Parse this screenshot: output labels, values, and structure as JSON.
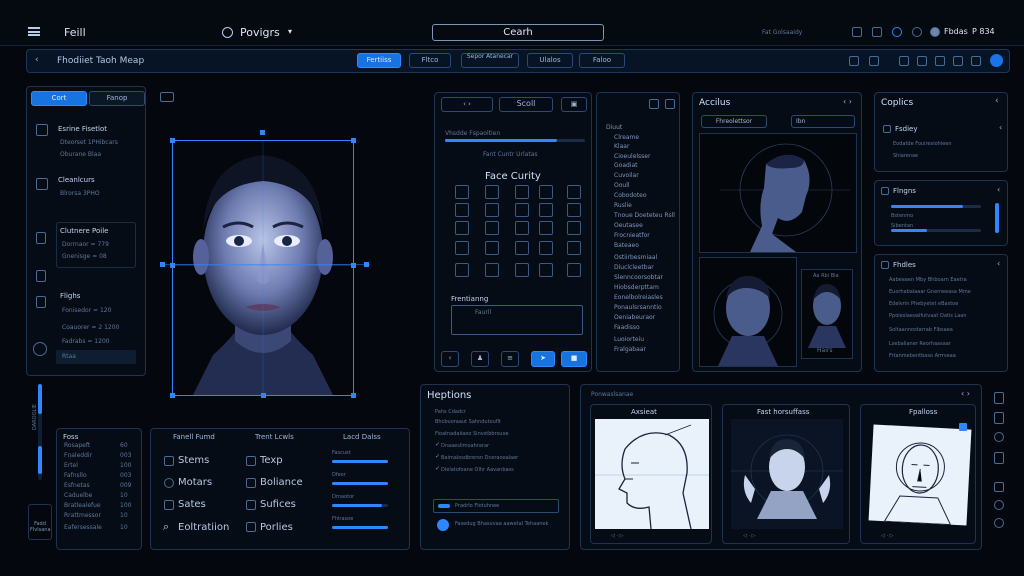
{
  "topbar": {
    "app_title": "Feill",
    "project_label": "Povigrs",
    "center_title": "Cearh",
    "right_label": "Fbdas",
    "right_value": "P 834",
    "sub_right": "Fat Golsaaidy"
  },
  "toolbar": {
    "path": "Fhodiiet Taoh Meap",
    "buttons": [
      "Fertiiss",
      "Fltco",
      "Sepor Atanecar",
      "Ulalos",
      "Faloo"
    ]
  },
  "left_tabs": [
    "Cort",
    "Fanop"
  ],
  "left_panel": {
    "sections": [
      {
        "title": "Esrine Fisetlot",
        "lines": [
          "Dteorset 1PHibcars",
          "Oburane Blaa"
        ]
      },
      {
        "title": "Cleanlcurs",
        "lines": [
          "Blrorsa 3PHO"
        ]
      },
      {
        "title": "Clutnere Poile",
        "lines": [
          "Dorrnaor = 779",
          "Gnenisge = 08"
        ]
      },
      {
        "title": "Flighs",
        "lines": [
          "Fonisedor = 120",
          "Coauorer = 2 1200",
          "Fadrabs = 1200"
        ]
      },
      {
        "title": "",
        "lines": [
          "Rtaa"
        ]
      }
    ],
    "vertical_label": "DAROOLIE",
    "bottom_btn": "Fadd Flvlsana"
  },
  "face_panel": {},
  "analysis_panel": {
    "tabs": [
      "Scoll"
    ],
    "subtitle": "Vhsdde Fspaoltien",
    "caption": "Fant Cuntr Urlatas",
    "title": "Face Curity",
    "grid_section": "Frentianng",
    "grid_label": "Faurll",
    "list": [
      "Diuut",
      "Clreame",
      "Klaar",
      "Cioeulelsser",
      "Goadiat",
      "Cuvoilar",
      "Ooull",
      "Cobodoteo",
      "Ruslie",
      "Tnoue Doeteteu Rsll",
      "Oeutasee",
      "Frocnieatfor",
      "Bateaeo",
      "Ostiirbesmiaal",
      "Diuclcleetbar",
      "Slenncoorsobtar",
      "Hiobsderpttam",
      "Eonelbolreiasles",
      "Ponaulsrsanntio",
      "Oeniabeuraor",
      "Faadisso",
      "Luoiorteiu",
      "Fralgabaar"
    ]
  },
  "accius_panel": {
    "title": "Accilus",
    "inputs": [
      "Fhreolettsor",
      "Ibn"
    ],
    "thumb_label": "Aa Rbi Bla",
    "thumb_caption": "Hairs"
  },
  "right_panels": {
    "top_title": "Coplics",
    "card1_title": "Fsdiey",
    "card1_lines": [
      "Eodatde Fouiresiohieen",
      "Shiarenae"
    ],
    "card2_title": "Flngns",
    "card2_lines": [
      "Bstenmo",
      "Sibentan"
    ],
    "card3_title": "Fhdles",
    "card3_lines": [
      "Aabeeaen Mby Bhboarn Eaetra",
      "Euorhabalaaar Gnemeeasa Mme",
      "Edelvrin Phebyetet eBastoe",
      "Ppoieslaeoalfutvaat Oatis Laan",
      "Soltaannostarrab Flbsaea",
      "Lsebalianer Reorhaasaar",
      "Frtanmebentbaso Arrrseaa"
    ]
  },
  "bottom_left": {
    "title": "Foss",
    "rows": [
      [
        "Rosapeft",
        "60"
      ],
      [
        "Fnaleddir",
        "003"
      ],
      [
        "Ertel",
        "100"
      ],
      [
        "Fafnsllo",
        "003"
      ],
      [
        "Esfnetas",
        "009"
      ],
      [
        "Caduelbe",
        "10"
      ],
      [
        "Bratlealefue",
        "100"
      ],
      [
        "Rrattmessor",
        "10"
      ],
      [
        "Eafersessale",
        "10"
      ]
    ]
  },
  "bottom_mid": {
    "headers": [
      "Fanell Fumd",
      "Trent Lcwls",
      "Lacd Dalss"
    ],
    "items": [
      "Stems",
      "Motars",
      "Sates",
      "Eoltratiion"
    ],
    "items2": [
      "Texp",
      "Boliance",
      "Sufices",
      "Porlies"
    ],
    "sliders": [
      "Fascust",
      "Dfeor",
      "Drnaotor",
      "Fhlrasoe"
    ]
  },
  "notes_panel": {
    "title": "Heptions",
    "lines": [
      "Pahs Cdadcr",
      "Bhcbuoraaut Sahndutouflt",
      "Fioatnadaiiaoo Sinvstbbrsuoe",
      "Dnaaesllmoahrarar",
      "Baimalosdbrersn Dceraooalaer",
      "Dielatofoane Olhr Aavanbass"
    ],
    "field": "Pradrlo Flotuhnee",
    "footer": "Fasedug Bhasuvaa aawetal Tehaanek"
  },
  "sketch_panel": {
    "header": "Ponwaslsanae",
    "cards": [
      "Axsieat",
      "Fast horsuffass",
      "Fpalloss"
    ]
  }
}
